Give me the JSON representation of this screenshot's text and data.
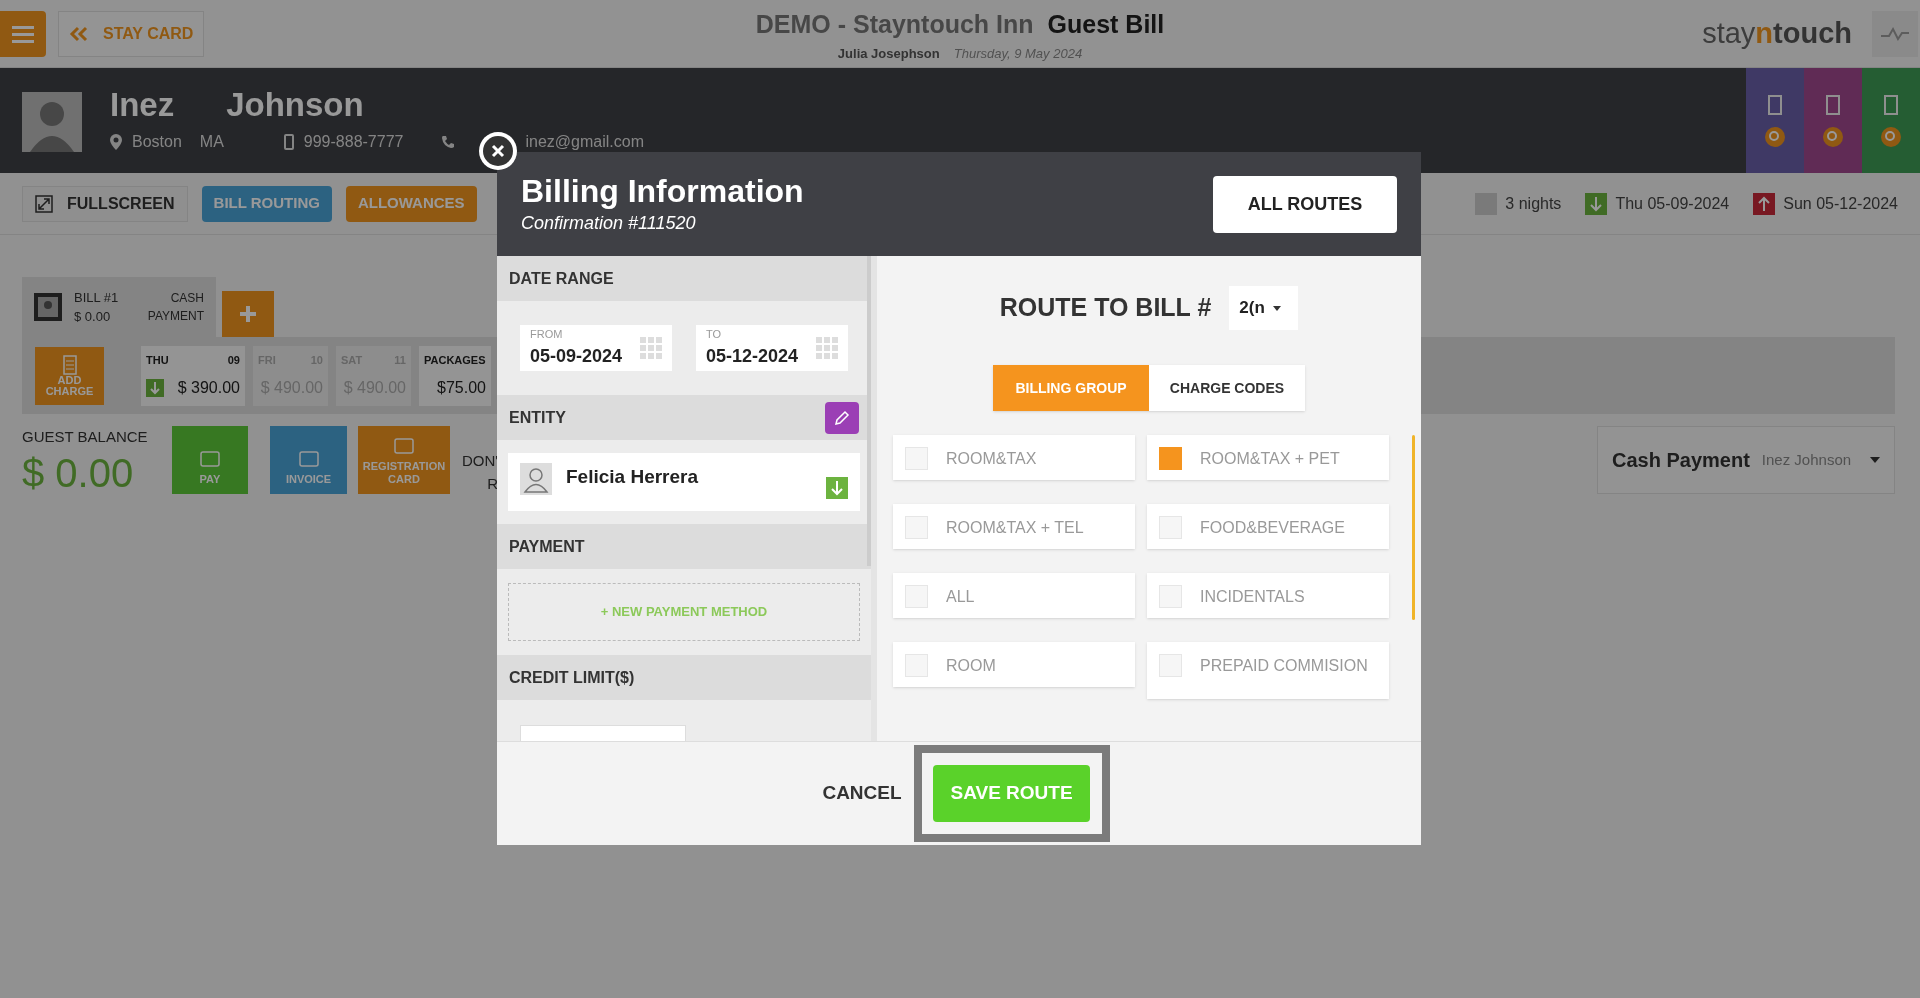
{
  "top_bar": {
    "back_label": "STAY CARD",
    "hotel": "DEMO - Stayntouch Inn",
    "page_title": "Guest Bill",
    "user": "Julia Josephson",
    "date": "Thursday, 9 May 2024",
    "logo": [
      "stay",
      "n",
      "touch"
    ]
  },
  "guest": {
    "first_name": "Inez",
    "last_name": "Johnson",
    "city": "Boston",
    "state": "MA",
    "mobile": "999-888-7777",
    "email": "inez@gmail.com"
  },
  "toolbar": {
    "fullscreen": "FULLSCREEN",
    "buttons": [
      {
        "label": "BILL ROUTING",
        "kind": "routing"
      },
      {
        "label": "ALLOWANCES",
        "kind": "allowances"
      }
    ]
  },
  "stay": {
    "nights": "3 nights",
    "arrival": "Thu 05-09-2024",
    "departure": "Sun 05-12-2024"
  },
  "bill": {
    "label": "BILL #1",
    "amount": "$ 0.00",
    "payment_type": [
      "CASH",
      "PAYMENT"
    ],
    "add_charge": [
      "ADD",
      "CHARGE"
    ],
    "days": [
      {
        "day": "THU",
        "date": "09",
        "amount": "$ 390.00",
        "dimmed": false,
        "arrival": true
      },
      {
        "day": "FRI",
        "date": "10",
        "amount": "$ 490.00",
        "dimmed": true,
        "arrival": false
      },
      {
        "day": "SAT",
        "date": "11",
        "amount": "$ 490.00",
        "dimmed": true,
        "arrival": false
      },
      {
        "day": "PACKAGES",
        "amount": "$75.00",
        "dimmed": false,
        "arrival": false
      }
    ]
  },
  "balance": {
    "label": "GUEST BALANCE",
    "amount": "$ 0.00",
    "actions": [
      {
        "label": [
          "PAY"
        ],
        "kind": "pay"
      },
      {
        "label": [
          "INVOICE"
        ],
        "kind": "invoice"
      },
      {
        "label": [
          "REGISTRATION",
          "CARD"
        ],
        "kind": "registration"
      }
    ],
    "cut_text": [
      "DON'",
      "R"
    ]
  },
  "payment_card": {
    "title": "Cash Payment",
    "payer": "Inez Johnson"
  },
  "modal": {
    "title": "Billing Information",
    "subtitle": "Confirmation #111520",
    "all_routes": "ALL ROUTES",
    "date_range": {
      "heading": "DATE RANGE",
      "fields": [
        {
          "label": "FROM",
          "value": "05-09-2024"
        },
        {
          "label": "TO",
          "value": "05-12-2024"
        }
      ]
    },
    "entity": {
      "heading": "ENTITY",
      "name": "Felicia Herrera"
    },
    "payment": {
      "heading": "PAYMENT",
      "new_method": "+ NEW PAYMENT METHOD"
    },
    "credit_limit": {
      "heading": "CREDIT LIMIT($)"
    },
    "route_label": "ROUTE TO BILL #",
    "route_value": "2(n",
    "tabs": [
      {
        "label": "BILLING GROUP",
        "selected": true
      },
      {
        "label": "CHARGE CODES",
        "selected": false
      }
    ],
    "groups": [
      {
        "label": "ROOM&TAX",
        "checked": false
      },
      {
        "label": "ROOM&TAX + PET",
        "checked": true
      },
      {
        "label": "ROOM&TAX + TEL",
        "checked": false
      },
      {
        "label": "FOOD&BEVERAGE",
        "checked": false
      },
      {
        "label": "ALL",
        "checked": false
      },
      {
        "label": "INCIDENTALS",
        "checked": false
      },
      {
        "label": "ROOM",
        "checked": false
      },
      {
        "label": "PREPAID COMMISION",
        "checked": false
      }
    ],
    "cancel": "CANCEL",
    "save": "SAVE ROUTE"
  }
}
